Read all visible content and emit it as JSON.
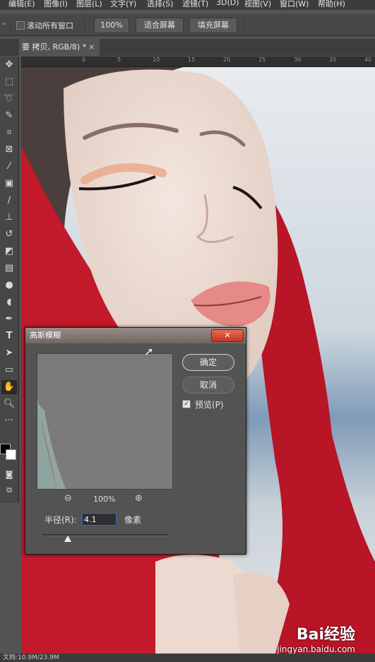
{
  "menu": [
    "编辑(E)",
    "图像(I)",
    "图层(L)",
    "文字(Y)",
    "选择(S)",
    "滤镜(T)",
    "3D(D)",
    "视图(V)",
    "窗口(W)",
    "帮助(H)"
  ],
  "options": {
    "scroll_all_label": "滚动所有窗口",
    "zoom_100": "100%",
    "fit_screen": "适合屏幕",
    "fill_screen": "填充屏幕"
  },
  "document_tab": {
    "title": "要 拷贝, RGB/8) *",
    "close": "×"
  },
  "ruler_labels": [
    "0",
    "5",
    "10",
    "15",
    "20",
    "25",
    "30",
    "35",
    "40"
  ],
  "dialog": {
    "title": "高斯模糊",
    "ok": "确定",
    "cancel": "取消",
    "preview_label": "预览(P)",
    "preview_checked": true,
    "zoom_level": "100%",
    "radius_label": "半径(R):",
    "radius_value": "4.1",
    "radius_unit": "像素",
    "radius_slider_fraction": 0.2
  },
  "status": {
    "text": "文档:10.9M/23.9M"
  },
  "watermark": {
    "logo": "Bai经验",
    "url": "jingyan.baidu.com"
  },
  "colors": {
    "accent_red": "#c21a2b",
    "ps_dark": "#535353",
    "close_red": "#d4432a"
  }
}
